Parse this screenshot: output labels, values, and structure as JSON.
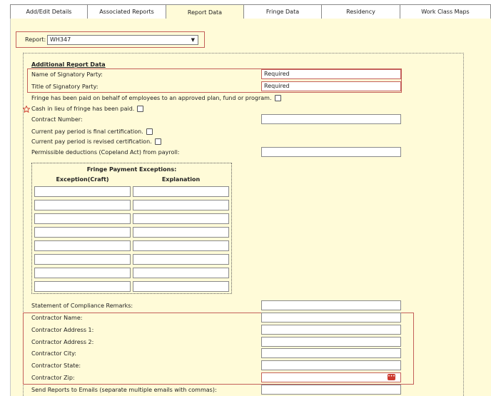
{
  "tabs": [
    "Add/Edit Details",
    "Associated Reports",
    "Report Data",
    "Fringe Data",
    "Residency",
    "Work Class Maps"
  ],
  "active_tab": "Report Data",
  "report": {
    "label": "Report:",
    "value": "WH347"
  },
  "section_title": "Additional Report Data",
  "fields": {
    "signatory_name": {
      "label": "Name of Signatory Party:",
      "value": "Required"
    },
    "signatory_title": {
      "label": "Title of Signatory Party:",
      "value": "Required"
    },
    "fringe_paid": {
      "label": "Fringe has been paid on behalf of employees to an approved plan, fund or program."
    },
    "cash_in_lieu": {
      "label": "Cash in lieu of fringe has been paid."
    },
    "contract_number": {
      "label": "Contract Number:",
      "value": ""
    },
    "final_cert": {
      "label": "Current pay period is final certification."
    },
    "revised_cert": {
      "label": "Current pay period is revised certification."
    },
    "permissible_deductions": {
      "label": "Permissible deductions (Copeland Act) from payroll:",
      "value": ""
    },
    "compliance_remarks": {
      "label": "Statement of Compliance Remarks:",
      "value": ""
    },
    "contractor_name": {
      "label": "Contractor Name:",
      "value": ""
    },
    "contractor_address1": {
      "label": "Contractor Address 1:",
      "value": ""
    },
    "contractor_address2": {
      "label": "Contractor Address 2:",
      "value": ""
    },
    "contractor_city": {
      "label": "Contractor City:",
      "value": ""
    },
    "contractor_state": {
      "label": "Contractor State:",
      "value": ""
    },
    "contractor_zip": {
      "label": "Contractor Zip:",
      "value": ""
    },
    "send_reports": {
      "label": "Send Reports to Emails (separate multiple emails with commas):",
      "value": ""
    }
  },
  "fringe_exceptions": {
    "title": "Fringe Payment Exceptions:",
    "col_exception": "Exception(Craft)",
    "col_explanation": "Explanation",
    "row_count": 8
  },
  "colors": {
    "panel_bg": "#fffbd8",
    "required_border": "#c4605a",
    "calendar_button": "#cc3a2e"
  }
}
